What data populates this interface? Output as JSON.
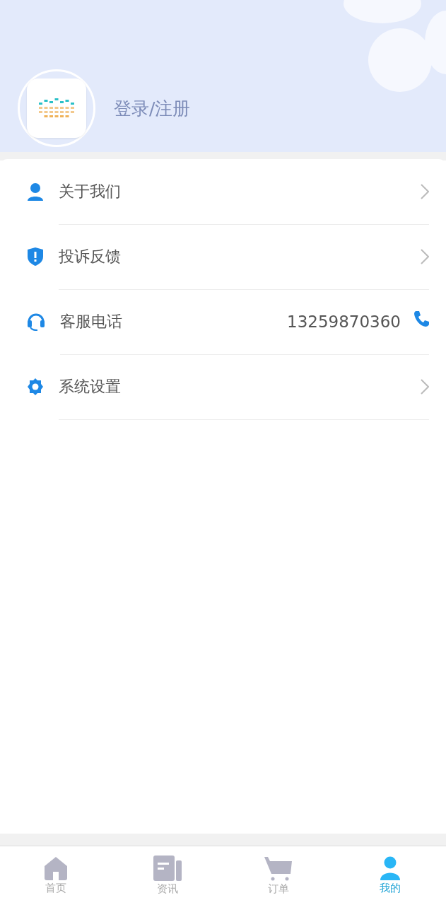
{
  "header": {
    "login_label": "登录/注册"
  },
  "menu": [
    {
      "kind": "about",
      "label": "关于我们"
    },
    {
      "kind": "complaint",
      "label": "投诉反馈"
    },
    {
      "kind": "phone",
      "label": "客服电话",
      "value": "13259870360"
    },
    {
      "kind": "settings",
      "label": "系统设置"
    }
  ],
  "tab_bar": [
    {
      "kind": "home",
      "label": "首页",
      "selected": false
    },
    {
      "kind": "news",
      "label": "资讯",
      "selected": false
    },
    {
      "kind": "cart",
      "label": "订单",
      "selected": false
    },
    {
      "kind": "user",
      "label": "我的",
      "selected": true
    }
  ]
}
